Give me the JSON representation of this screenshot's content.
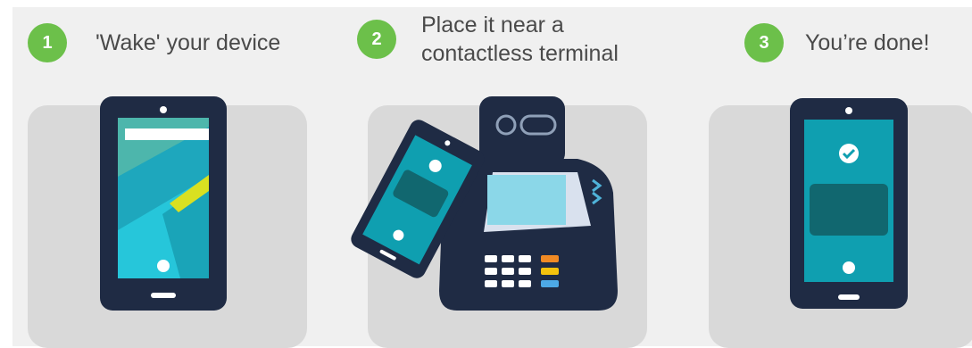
{
  "steps": [
    {
      "number": "1",
      "title": "'Wake' your device"
    },
    {
      "number": "2",
      "title": "Place it near a contactless terminal"
    },
    {
      "number": "3",
      "title": "You’re done!"
    }
  ],
  "icons": {
    "step1": "phone-wake-screen-icon",
    "step2": "phone-to-contactless-terminal-icon",
    "step3": "phone-payment-complete-checkmark-icon"
  },
  "colors": {
    "badge_green": "#6cc04a",
    "phone_navy": "#1f2b44",
    "screen_teal": "#0f9fb0",
    "panel_gray": "#d9d9d9",
    "background_gray": "#f0f0f0"
  }
}
